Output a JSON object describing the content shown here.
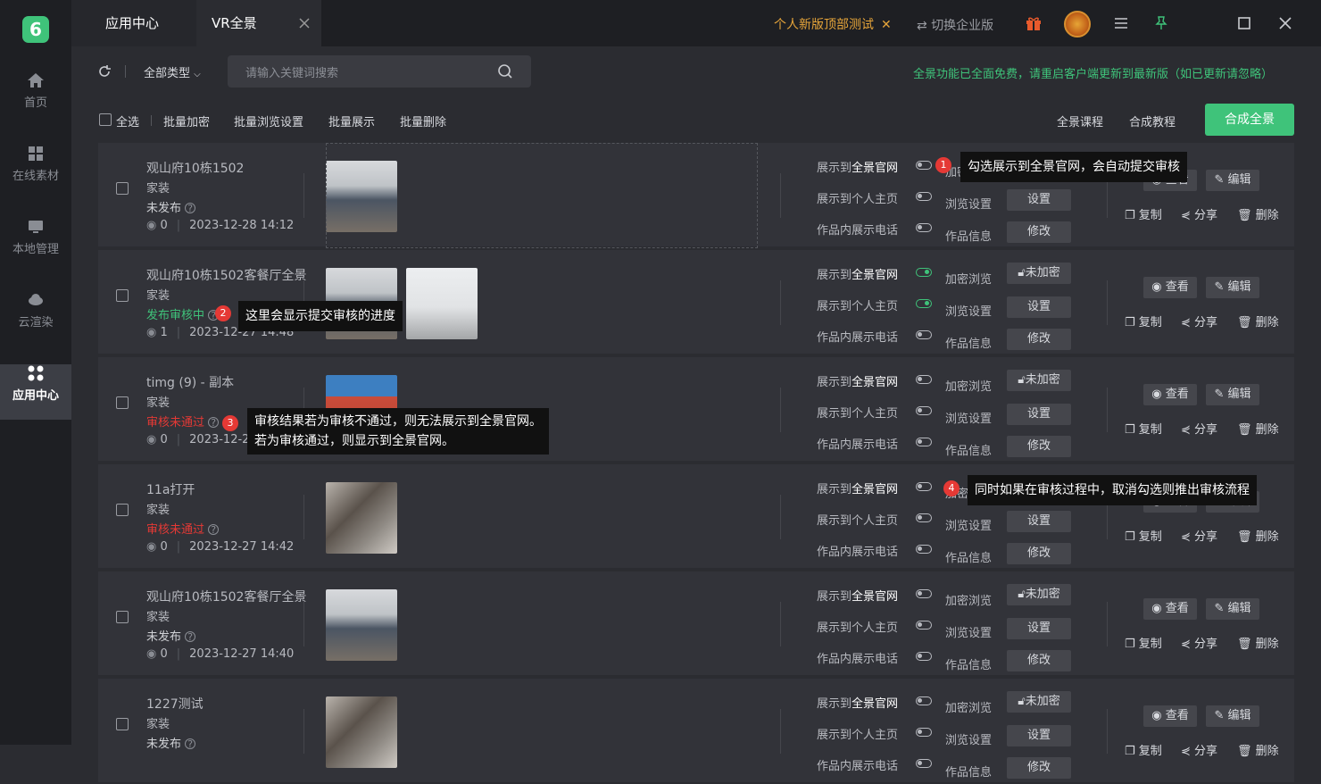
{
  "sidebar": {
    "items": [
      {
        "label": "首页"
      },
      {
        "label": "在线素材"
      },
      {
        "label": "本地管理"
      },
      {
        "label": "云渲染"
      },
      {
        "label": "应用中心"
      }
    ]
  },
  "tabs": {
    "app_center": "应用中心",
    "vr": "VR全景"
  },
  "topbar": {
    "promo": "个人新版顶部测试",
    "switch": "切换企业版"
  },
  "toolbar": {
    "type_filter": "全部类型",
    "search_placeholder": "请输入关键词搜索",
    "notice": "全景功能已全面免费，请重启客户端更新到最新版（如已更新请忽略）"
  },
  "bulk": {
    "select_all": "全选",
    "encrypt": "批量加密",
    "browse": "批量浏览设置",
    "display": "批量展示",
    "delete": "批量删除",
    "course": "全景课程",
    "tutorial": "合成教程",
    "compose": "合成全景"
  },
  "labels": {
    "show_official": "展示到",
    "official": "全景官网",
    "show_personal": "展示到个人主页",
    "show_phone": "作品内展示电话",
    "encrypt_browse": "加密浏览",
    "browse_settings": "浏览设置",
    "work_info": "作品信息",
    "set": "设置",
    "modify": "修改",
    "unencrypted": "未加密",
    "view": "查看",
    "edit": "编辑",
    "copy": "复制",
    "share": "分享",
    "delete": "删除"
  },
  "rows": [
    {
      "title": "观山府10栋1502",
      "cat": "家装",
      "status": "未发布",
      "views": "0",
      "date": "2023-12-28 14:12"
    },
    {
      "title": "观山府10栋1502客餐厅全景",
      "cat": "家装",
      "status": "发布审核中",
      "views": "1",
      "date": "2023-12-27 14:48"
    },
    {
      "title": "timg (9) - 副本",
      "cat": "家装",
      "status": "审核未通过",
      "views": "0",
      "date": "2023-12-2"
    },
    {
      "title": "11a打开",
      "cat": "家装",
      "status": "审核未通过",
      "views": "0",
      "date": "2023-12-27 14:42"
    },
    {
      "title": "观山府10栋1502客餐厅全景",
      "cat": "家装",
      "status": "未发布",
      "views": "0",
      "date": "2023-12-27 14:40"
    },
    {
      "title": "1227测试",
      "cat": "家装",
      "status": "未发布",
      "views": "",
      "date": ""
    }
  ],
  "tips": {
    "t1": "勾选展示到全景官网，会自动提交审核",
    "t2": "这里会显示提交审核的进度",
    "t3a": "审核结果若为审核不通过，则无法展示到全景官网。",
    "t3b": "若为审核通过，则显示到全景官网。",
    "t4": "同时如果在审核过程中，取消勾选则推出审核流程",
    "n1": "1",
    "n2": "2",
    "n3": "3",
    "n4": "4"
  },
  "colors": {
    "accent": "#3fc37a",
    "promo": "#e5a43a",
    "rejected": "#e53935"
  }
}
